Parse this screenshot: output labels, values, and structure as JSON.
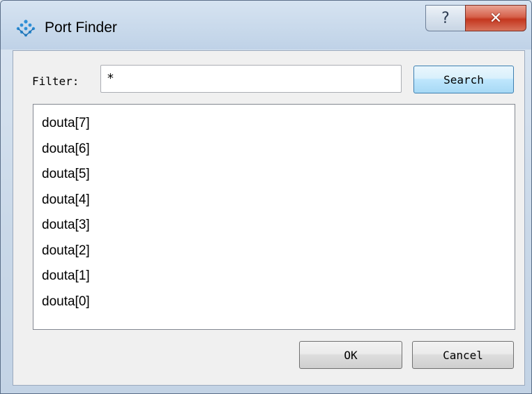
{
  "window": {
    "title": "Port Finder",
    "icon": "app-logo-icon",
    "help_label": "?",
    "close_label": "✕"
  },
  "filter": {
    "label": "Filter:",
    "value": "*",
    "search_label": "Search"
  },
  "ports": [
    "douta[7]",
    "douta[6]",
    "douta[5]",
    "douta[4]",
    "douta[3]",
    "douta[2]",
    "douta[1]",
    "douta[0]"
  ],
  "buttons": {
    "ok_label": "OK",
    "cancel_label": "Cancel"
  },
  "colors": {
    "close_button": "#c4371f",
    "logo": "#2f8fd6",
    "search_button_border": "#3c7fb1"
  }
}
